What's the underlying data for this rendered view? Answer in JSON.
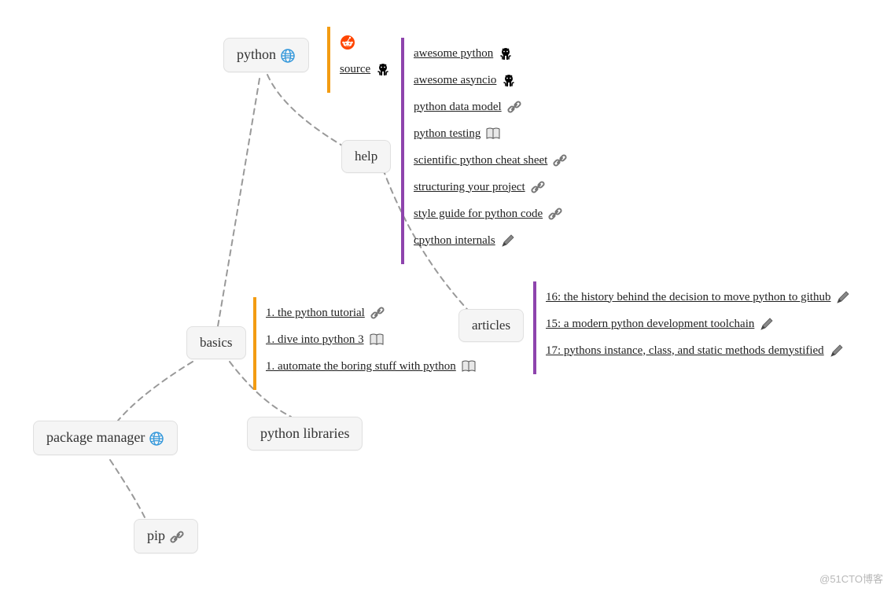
{
  "nodes": {
    "python": {
      "label": "python",
      "icon": "globe-icon"
    },
    "help": {
      "label": "help"
    },
    "basics": {
      "label": "basics"
    },
    "articles": {
      "label": "articles"
    },
    "package_manager": {
      "label": "package manager",
      "icon": "globe-icon"
    },
    "python_libraries": {
      "label": "python libraries"
    },
    "pip": {
      "label": "pip",
      "icon": "link-icon"
    }
  },
  "python_links": [
    {
      "label": "",
      "icon": "reddit-icon"
    },
    {
      "label": "source",
      "icon": "github-icon"
    }
  ],
  "help_links": [
    {
      "label": "awesome python",
      "icon": "github-icon"
    },
    {
      "label": "awesome asyncio",
      "icon": "github-icon"
    },
    {
      "label": "python data model",
      "icon": "link-icon"
    },
    {
      "label": "python testing",
      "icon": "book-icon"
    },
    {
      "label": "scientific python cheat sheet",
      "icon": "link-icon"
    },
    {
      "label": "structuring your project",
      "icon": "link-icon"
    },
    {
      "label": "style guide for python code",
      "icon": "link-icon"
    },
    {
      "label": "cpython internals",
      "icon": "pen-icon"
    }
  ],
  "basics_links": [
    {
      "label": "1. the python tutorial",
      "icon": "link-icon"
    },
    {
      "label": "1. dive into python 3",
      "icon": "book-icon"
    },
    {
      "label": "1. automate the boring stuff with python",
      "icon": "book-icon"
    }
  ],
  "articles_links": [
    {
      "label": "16: the history behind the decision to move python to github",
      "icon": "pen-icon"
    },
    {
      "label": "15: a modern python development toolchain",
      "icon": "pen-icon"
    },
    {
      "label": "17: pythons instance, class, and static methods demystified",
      "icon": "pen-icon"
    }
  ],
  "colors": {
    "orange": "#f39c12",
    "purple": "#8e44ad"
  },
  "watermark": "@51CTO博客"
}
